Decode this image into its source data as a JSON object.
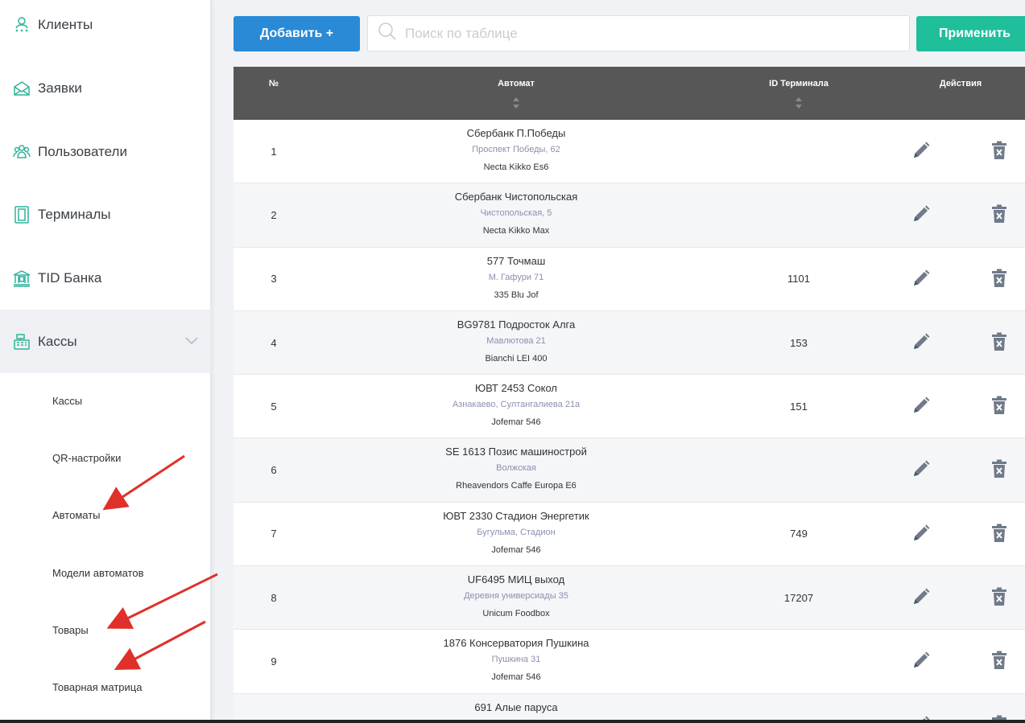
{
  "sidebar": {
    "items": [
      {
        "label": "Клиенты",
        "icon": "clients-icon"
      },
      {
        "label": "Заявки",
        "icon": "mail-icon"
      },
      {
        "label": "Пользователи",
        "icon": "users-icon"
      },
      {
        "label": "Терминалы",
        "icon": "terminal-icon"
      },
      {
        "label": "TID Банка",
        "icon": "bank-icon"
      },
      {
        "label": "Кассы",
        "icon": "cash-register-icon",
        "active": true
      }
    ],
    "subitems": [
      "Кассы",
      "QR-настройки",
      "Автоматы",
      "Модели автоматов",
      "Товары",
      "Товарная матрица"
    ]
  },
  "toolbar": {
    "add_label": "Добавить +",
    "search_placeholder": "Поиск по таблице",
    "apply_label": "Применить"
  },
  "colors": {
    "accent_blue": "#2a8ad6",
    "accent_green": "#1fbf9c",
    "table_header": "#575757",
    "annotation_arrow": "#e0302a"
  },
  "table": {
    "headers": {
      "num": "№",
      "automat": "Автомат",
      "terminal_id": "ID Терминала",
      "actions": "Действия"
    },
    "rows": [
      {
        "num": "1",
        "name": "Сбербанк П.Победы",
        "address": "Проспект Победы, 62",
        "model": "Necta Kikko Es6",
        "terminal_id": ""
      },
      {
        "num": "2",
        "name": "Сбербанк Чистопольская",
        "address": "Чистопольская, 5",
        "model": "Necta Kikko Max",
        "terminal_id": ""
      },
      {
        "num": "3",
        "name": "577 Точмаш",
        "address": "М. Гафури 71",
        "model": "335 Blu Jof",
        "terminal_id": "1101"
      },
      {
        "num": "4",
        "name": "BG9781 Подросток Алга",
        "address": "Мавлютова 21",
        "model": "Bianchi LEI 400",
        "terminal_id": "153"
      },
      {
        "num": "5",
        "name": "ЮВТ 2453 Сокол",
        "address": "Азнакаево, Султангалиева 21а",
        "model": "Jofemar 546",
        "terminal_id": "151"
      },
      {
        "num": "6",
        "name": "SE 1613 Позис машинострой",
        "address": "Волжская",
        "model": "Rheavendors Caffe Europa E6",
        "terminal_id": ""
      },
      {
        "num": "7",
        "name": "ЮВТ 2330 Стадион Энергетик",
        "address": "Бугульма, Стадион",
        "model": "Jofemar 546",
        "terminal_id": "749"
      },
      {
        "num": "8",
        "name": "UF6495 МИЦ выход",
        "address": "Деревня универсиады 35",
        "model": "Unicum Foodbox",
        "terminal_id": "17207"
      },
      {
        "num": "9",
        "name": "1876 Консерватория Пушкина",
        "address": "Пушкина 31",
        "model": "Jofemar 546",
        "terminal_id": ""
      },
      {
        "num": "",
        "name": "691 Алые паруса",
        "address": "",
        "model": "",
        "terminal_id": ""
      }
    ]
  }
}
